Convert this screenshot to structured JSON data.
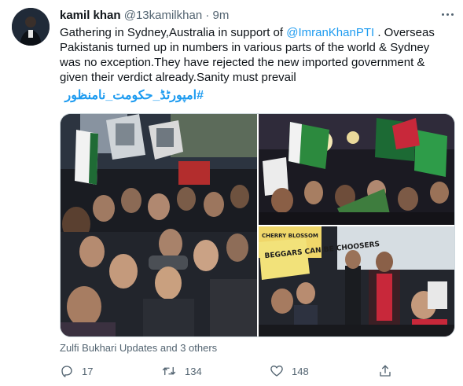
{
  "tweet": {
    "author_name": "kamil khan",
    "author_handle": "@13kamilkhan",
    "separator": "·",
    "time": "9m",
    "text_part1": "Gathering in Sydney,Australia in support of ",
    "mention": "@ImranKhanPTI",
    "text_part2": " . Overseas Pakistanis turned up in numbers in various parts of the world & Sydney was no exception.They have rejected the new imported government & given their verdict already.Sanity must prevail",
    "hashtag": "#امپورٹڈ_حکومت_نامنظور",
    "tagged_text": "Zulfi Bukhari Updates and 3 others",
    "placard_text": "BEGGARS CAN BE CHOOSERS",
    "sign_text": "CHERRY BLOSSOM"
  },
  "actions": {
    "reply_count": "17",
    "retweet_count": "134",
    "like_count": "148"
  },
  "icons": {
    "more": "more-dots-icon",
    "reply": "reply-icon",
    "retweet": "retweet-icon",
    "like": "heart-icon",
    "share": "share-icon"
  },
  "colors": {
    "link": "#1d9bf0",
    "secondary_text": "#536471",
    "primary_text": "#0f1419"
  }
}
